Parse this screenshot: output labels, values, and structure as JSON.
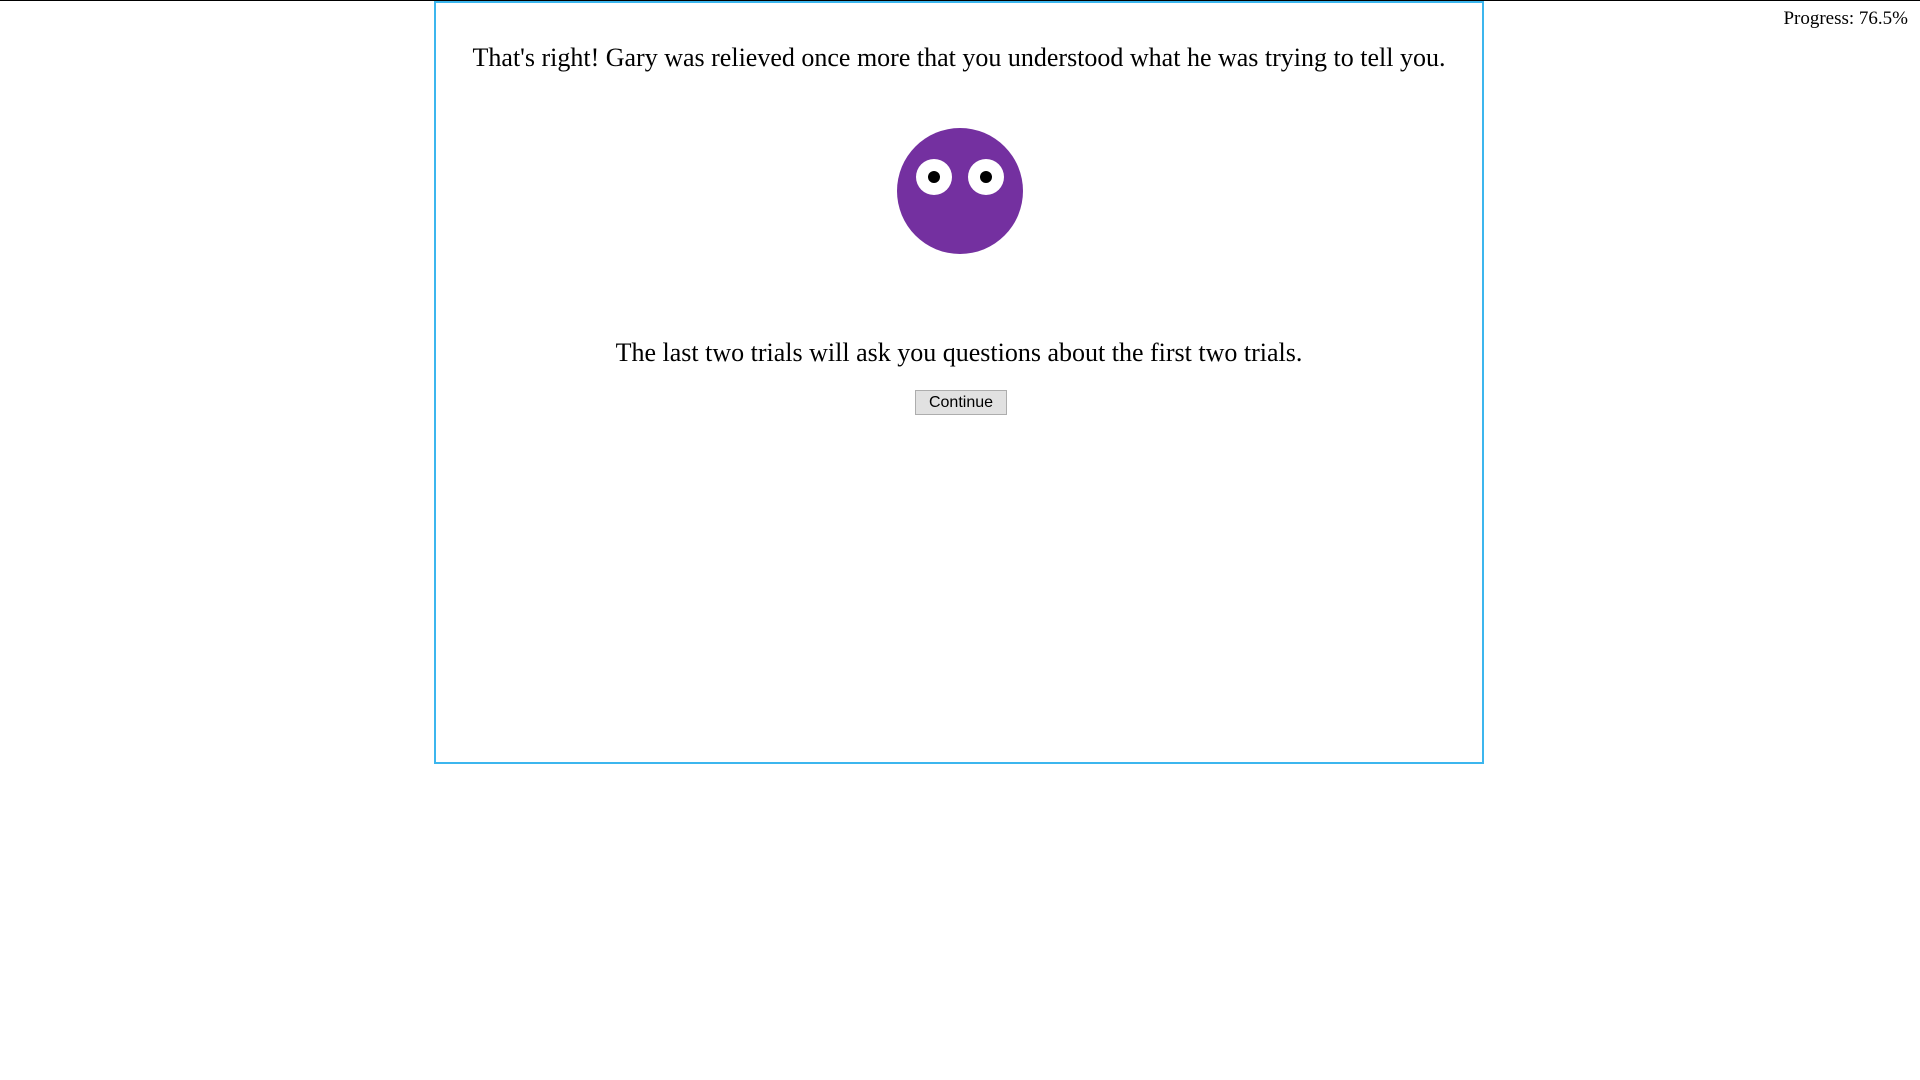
{
  "progress": {
    "label": "Progress: 76.5%",
    "value_percent": 76.5
  },
  "trial": {
    "feedback": "That's right! Gary was relieved once more that you understood what he was trying to tell you.",
    "instruction": "The last two trials will ask you questions about the first two trials.",
    "continue_label": "Continue"
  },
  "character": {
    "icon": "purple-face-icon",
    "body_color": "#7430a0",
    "eye_color": "#ffffff",
    "pupil_color": "#000000"
  },
  "colors": {
    "panel_border": "#3cb6ee"
  }
}
